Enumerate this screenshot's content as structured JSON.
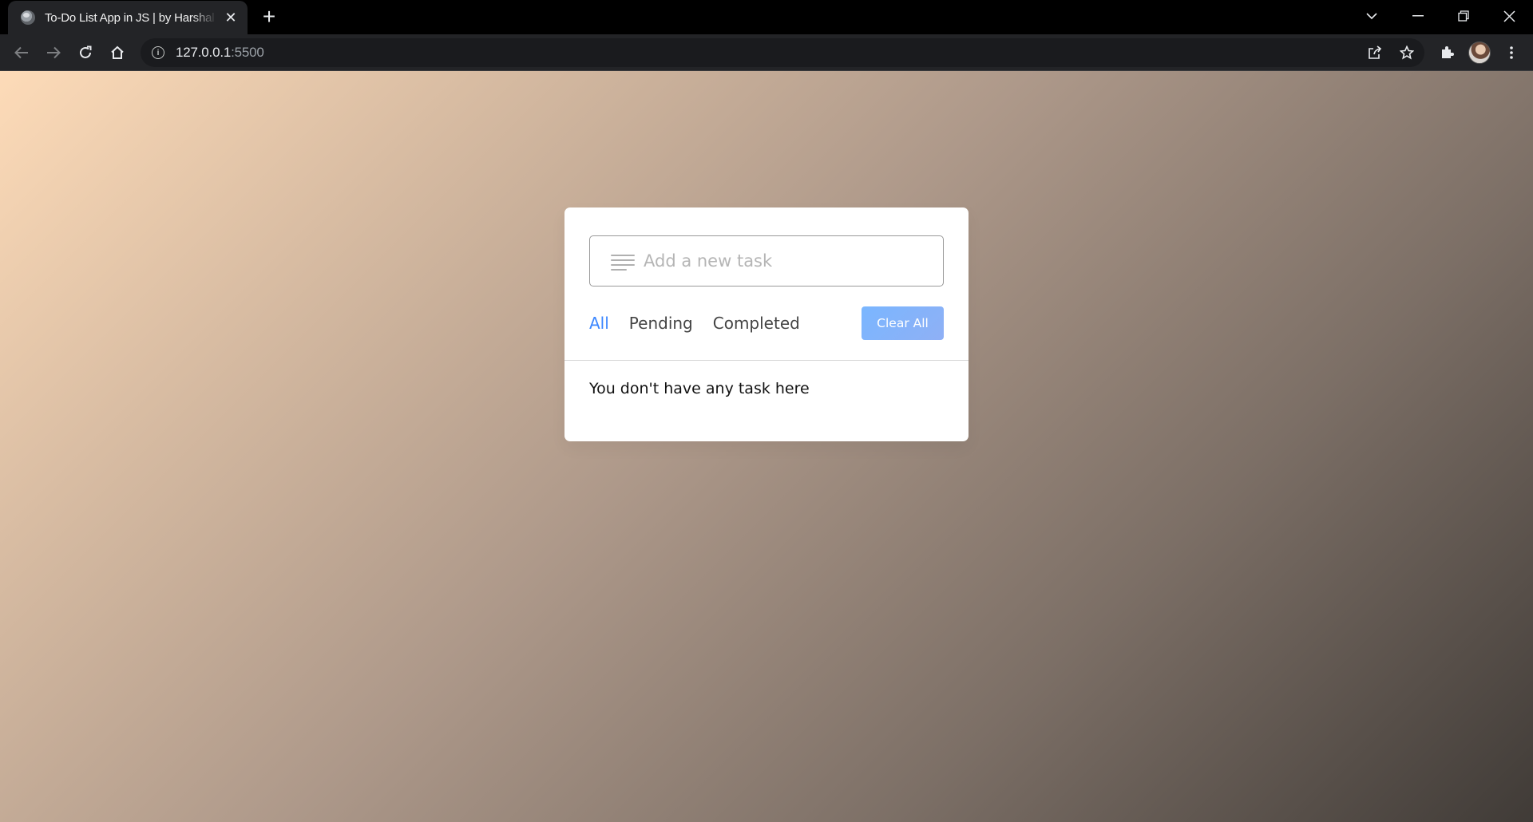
{
  "browser": {
    "tab_title": "To-Do List App in JS | by Harshal",
    "tab_close": "✕",
    "new_tab": "+",
    "url_host": "127.0.0.1",
    "url_port": ":5500"
  },
  "app": {
    "input_placeholder": "Add a new task",
    "filters": [
      "All",
      "Pending",
      "Completed"
    ],
    "active_filter": "All",
    "clear_button": "Clear All",
    "empty_message": "You don't have any task here",
    "accent_color": "#3C87FF"
  }
}
